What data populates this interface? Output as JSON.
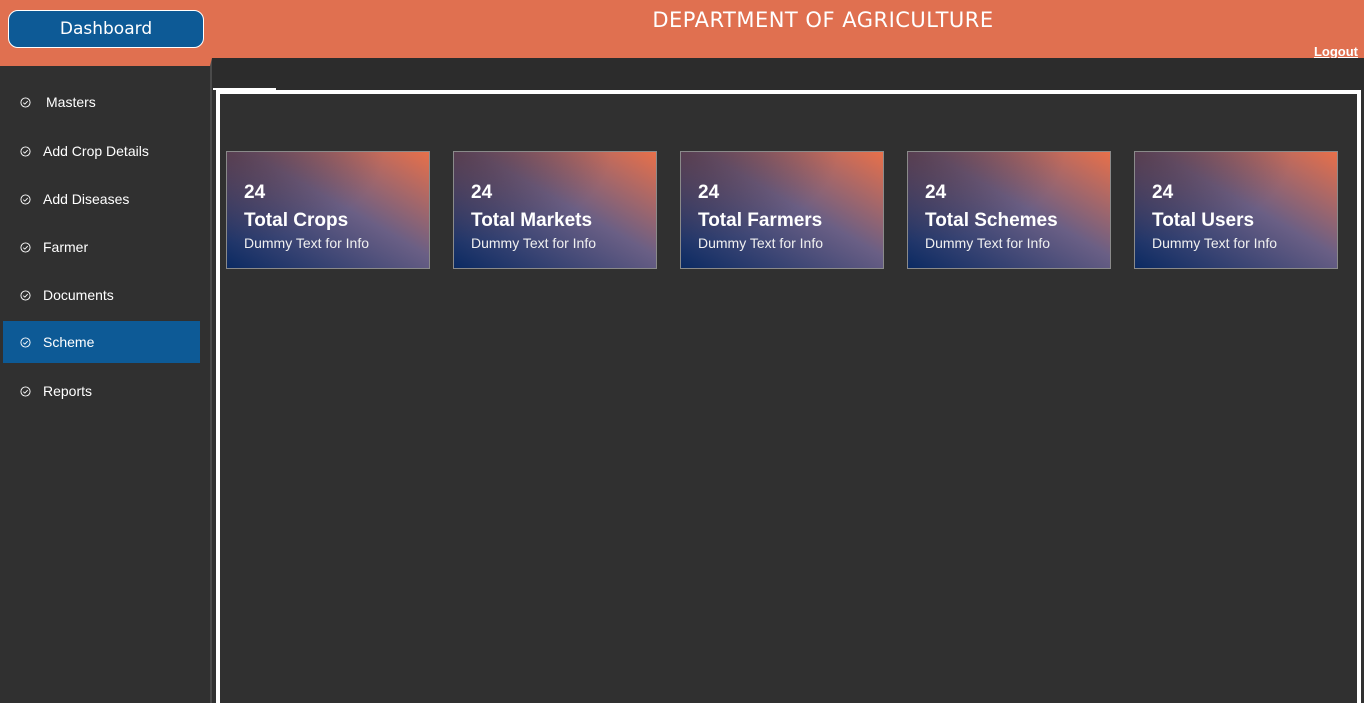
{
  "header": {
    "dashboard_label": "Dashboard",
    "title": "DEPARTMENT OF AGRICULTURE",
    "logout_label": "Logout"
  },
  "sidebar": {
    "items": [
      {
        "label": "Masters",
        "icon": "check-circle-icon"
      },
      {
        "label": "Add Crop Details",
        "icon": "check-circle-icon"
      },
      {
        "label": "Add Diseases",
        "icon": "check-circle-icon"
      },
      {
        "label": "Farmer",
        "icon": "check-circle-icon"
      },
      {
        "label": "Documents",
        "icon": "check-circle-icon"
      },
      {
        "label": "Scheme",
        "icon": "check-circle-icon",
        "active": true
      },
      {
        "label": "Reports",
        "icon": "check-circle-icon"
      }
    ]
  },
  "cards": [
    {
      "count": "24",
      "title": "Total Crops",
      "subtitle": "Dummy Text for Info"
    },
    {
      "count": "24",
      "title": "Total Markets",
      "subtitle": "Dummy Text for Info"
    },
    {
      "count": "24",
      "title": "Total Farmers",
      "subtitle": "Dummy Text for Info"
    },
    {
      "count": "24",
      "title": "Total Schemes",
      "subtitle": "Dummy Text for Info"
    },
    {
      "count": "24",
      "title": "Total Users",
      "subtitle": "Dummy Text for Info"
    }
  ],
  "colors": {
    "header": "#e07050",
    "accent": "#0d5a96",
    "background": "#303030"
  }
}
